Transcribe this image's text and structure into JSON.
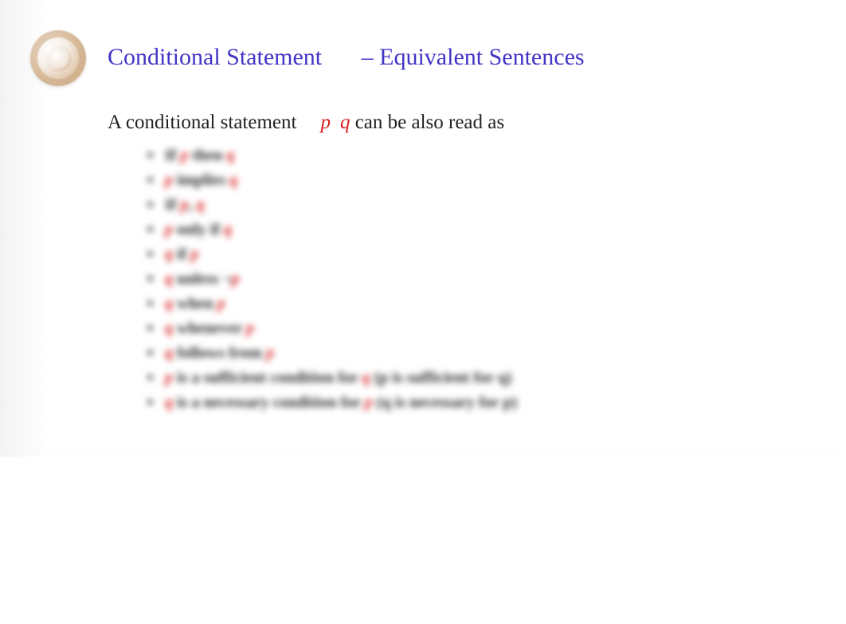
{
  "title": {
    "part1": "Conditional Statement",
    "part2": "– Equivalent Sentences"
  },
  "intro": {
    "prefix": "A conditional statement",
    "p": "p",
    "q": "q",
    "suffix": "can be also read as"
  },
  "items": [
    {
      "pre": "If ",
      "v1": "p",
      "mid": " then ",
      "v2": "q"
    },
    {
      "pre": "",
      "v1": "p",
      "mid": " implies ",
      "v2": "q"
    },
    {
      "pre": "If ",
      "v1": "p",
      "mid": ", ",
      "v2": "q"
    },
    {
      "pre": "",
      "v1": "p",
      "mid": " only if ",
      "v2": "q"
    },
    {
      "pre": "",
      "v1": "q",
      "mid": " if ",
      "v2": "p"
    },
    {
      "pre": "",
      "v1": "q",
      "mid": " unless ¬",
      "v2": "p"
    },
    {
      "pre": "",
      "v1": "q",
      "mid": " when ",
      "v2": "p"
    },
    {
      "pre": "",
      "v1": "q",
      "mid": " whenever ",
      "v2": "p"
    },
    {
      "pre": "",
      "v1": "q",
      "mid": " follows from ",
      "v2": "p"
    },
    {
      "pre": "",
      "v1": "p",
      "mid": " is a sufficient condition for ",
      "v2": "q",
      "tail": " (p is sufficient for q)"
    },
    {
      "pre": "",
      "v1": "q",
      "mid": " is a necessary condition for ",
      "v2": "p",
      "tail": " (q is necessary for p)"
    }
  ]
}
